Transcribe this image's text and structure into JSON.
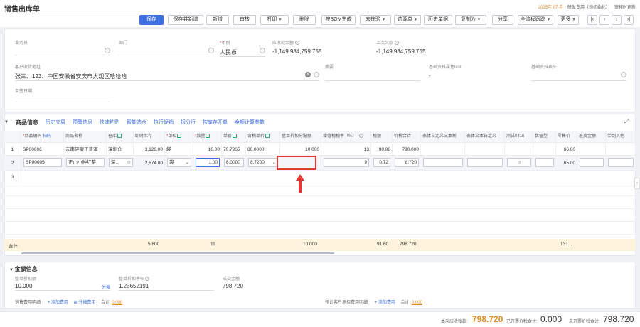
{
  "app": {
    "title": "销售出库单",
    "date": "2025年 07 月",
    "org": "研发专用（勿初始化）",
    "mode": "审核时更新"
  },
  "toolbar": {
    "save": "保存",
    "save_new": "保存并新增",
    "add": "新增",
    "audit": "审核",
    "print": "打印",
    "delete": "删除",
    "bom": "按BOM生成",
    "pick": "去拣验",
    "select_doc": "选源单",
    "history": "历史单据",
    "copy_as": "复制为",
    "share": "分享",
    "trace": "全流程跟踪",
    "more": "更多"
  },
  "header": {
    "salesperson_label": "业务员",
    "dept_label": "部门",
    "currency_label": "币别",
    "currency_value": "人民币",
    "receivable_label": "应收款余额",
    "receivable_value": "-1,149,984,759.755",
    "last_debt_label": "上次欠款",
    "last_debt_value": "-1,149,984,759.755",
    "address_label": "客户收货地址",
    "address_value": "张三、123、中国安徽省安庆市大观区哈哈哈",
    "summary_label": "摘要",
    "basic_attr_label": "基础资料属性test",
    "basic_attr_value": "-",
    "basic_header_label": "基础资料表头",
    "sign_date_label": "单签日期"
  },
  "goods": {
    "section_title": "商品信息",
    "actions": [
      "历史交易",
      "预警信息",
      "快速粘贴",
      "智能选仓",
      "执行促销",
      "拆分行",
      "按库存开单",
      "金额计算参数"
    ],
    "columns": [
      "",
      "商品编码",
      "商品名称",
      "仓库",
      "即时库存",
      "单位",
      "数量",
      "单价",
      "含税单价",
      "整单折扣分配额",
      "增值税税率（%）",
      "税额",
      "价税合计",
      "表体自定义文本新",
      "表体文本自定义",
      "测试0415",
      "数值型",
      "零售价",
      "退货金额",
      "带到其他"
    ],
    "scan_label": "扫码",
    "rows": [
      {
        "no": "1",
        "code": "SP00006",
        "name": "云南碎银子普洱",
        "warehouse": "深圳仓",
        "stock": "3,126.00",
        "unit": "袋",
        "qty": "10.00",
        "price": "70.7965",
        "tax_price": "80.0000",
        "discount": "10.000",
        "tax_rate": "13",
        "tax": "90.88",
        "total": "790.000",
        "retail": "66.00"
      },
      {
        "no": "2",
        "code": "SP00005",
        "name": "正山小种红茶",
        "warehouse": "深...",
        "stock": "2,674.00",
        "unit": "袋",
        "qty": "1.00",
        "price": "8.0000",
        "tax_price": "8.7200",
        "discount": "",
        "tax_rate": "9",
        "tax": "0.72",
        "total": "8.720",
        "retail": "65.00"
      },
      {
        "no": "3"
      }
    ],
    "sum": {
      "label": "合计",
      "stock": "5,800",
      "qty": "11",
      "discount": "10.000",
      "tax": "91.60",
      "total": "798.720",
      "retail": "131..."
    }
  },
  "amount": {
    "section_title": "金额信息",
    "discount_label": "整单折扣额",
    "discount_value": "10.000",
    "split_label": "分摊",
    "discount_rate_label": "整单折扣率%",
    "discount_rate_value": "1.23652191",
    "deal_label": "成交金额",
    "deal_value": "798.720",
    "fee_label": "销售费用明细",
    "add_fee": "添加费用",
    "split_fee": "分摊费用",
    "total_label": "合计:",
    "total_value": "0.000",
    "customer_fee_label": "预计客户承担费用明细",
    "add_fee2": "添加费用",
    "total_value2": "0.000"
  },
  "footer": {
    "receivable_label": "本次应收账款:",
    "receivable_value": "798.720",
    "invoiced_label": "已开票价税合计:",
    "invoiced_value": "0.000",
    "uninvoiced_label": "未开票价税合计:",
    "uninvoiced_value": "798.720"
  }
}
